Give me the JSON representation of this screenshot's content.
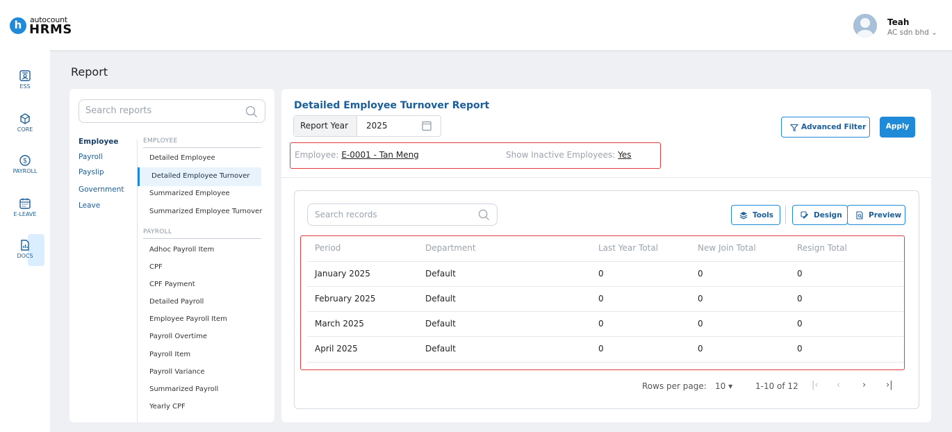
{
  "brand": {
    "top": "autocount",
    "main": "HRMS",
    "mark": "h"
  },
  "user": {
    "name": "Teah",
    "company": "AC sdn bhd"
  },
  "rail": [
    {
      "label": "ESS",
      "icon": "id-card-icon"
    },
    {
      "label": "CORE",
      "icon": "cube-icon"
    },
    {
      "label": "PAYROLL",
      "icon": "dollar-circle-icon"
    },
    {
      "label": "E-LEAVE",
      "icon": "calendar-icon"
    },
    {
      "label": "DOCS",
      "icon": "document-chart-icon"
    }
  ],
  "page_title": "Report",
  "search_reports_placeholder": "Search reports",
  "categories": [
    "Employee",
    "Payroll",
    "Payslip",
    "Government",
    "Leave"
  ],
  "sections": {
    "employee": {
      "header": "EMPLOYEE",
      "items": [
        "Detailed Employee",
        "Detailed Employee Turnover",
        "Summarized Employee",
        "Summarized Employee Turnover"
      ]
    },
    "payroll": {
      "header": "PAYROLL",
      "items": [
        "Adhoc Payroll Item",
        "CPF",
        "CPF Payment",
        "Detailed Payroll",
        "Employee Payroll Item",
        "Payroll Overtime",
        "Payroll Item",
        "Payroll Variance",
        "Summarized Payroll",
        "Yearly CPF"
      ]
    }
  },
  "report": {
    "title": "Detailed Employee Turnover Report",
    "year_label": "Report Year",
    "year_value": "2025",
    "filter_employee_label": "Employee:",
    "filter_employee_value": "E-0001 - Tan Meng",
    "filter_inactive_label": "Show Inactive Employees:",
    "filter_inactive_value": "Yes",
    "advanced_filter": "Advanced Filter",
    "apply": "Apply"
  },
  "toolbar": {
    "search_placeholder": "Search records",
    "tools": "Tools",
    "design": "Design",
    "preview": "Preview"
  },
  "table": {
    "headers": [
      "Period",
      "Department",
      "Last Year Total",
      "New Join Total",
      "Resign Total"
    ],
    "rows": [
      [
        "January 2025",
        "Default",
        "0",
        "0",
        "0"
      ],
      [
        "February 2025",
        "Default",
        "0",
        "0",
        "0"
      ],
      [
        "March 2025",
        "Default",
        "0",
        "0",
        "0"
      ],
      [
        "April 2025",
        "Default",
        "0",
        "0",
        "0"
      ]
    ]
  },
  "pager": {
    "rows_label": "Rows per page:",
    "rows_value": "10",
    "range": "1-10 of 12"
  },
  "colors": {
    "accent": "#1f8bd8",
    "highlight": "#e03b3b"
  }
}
